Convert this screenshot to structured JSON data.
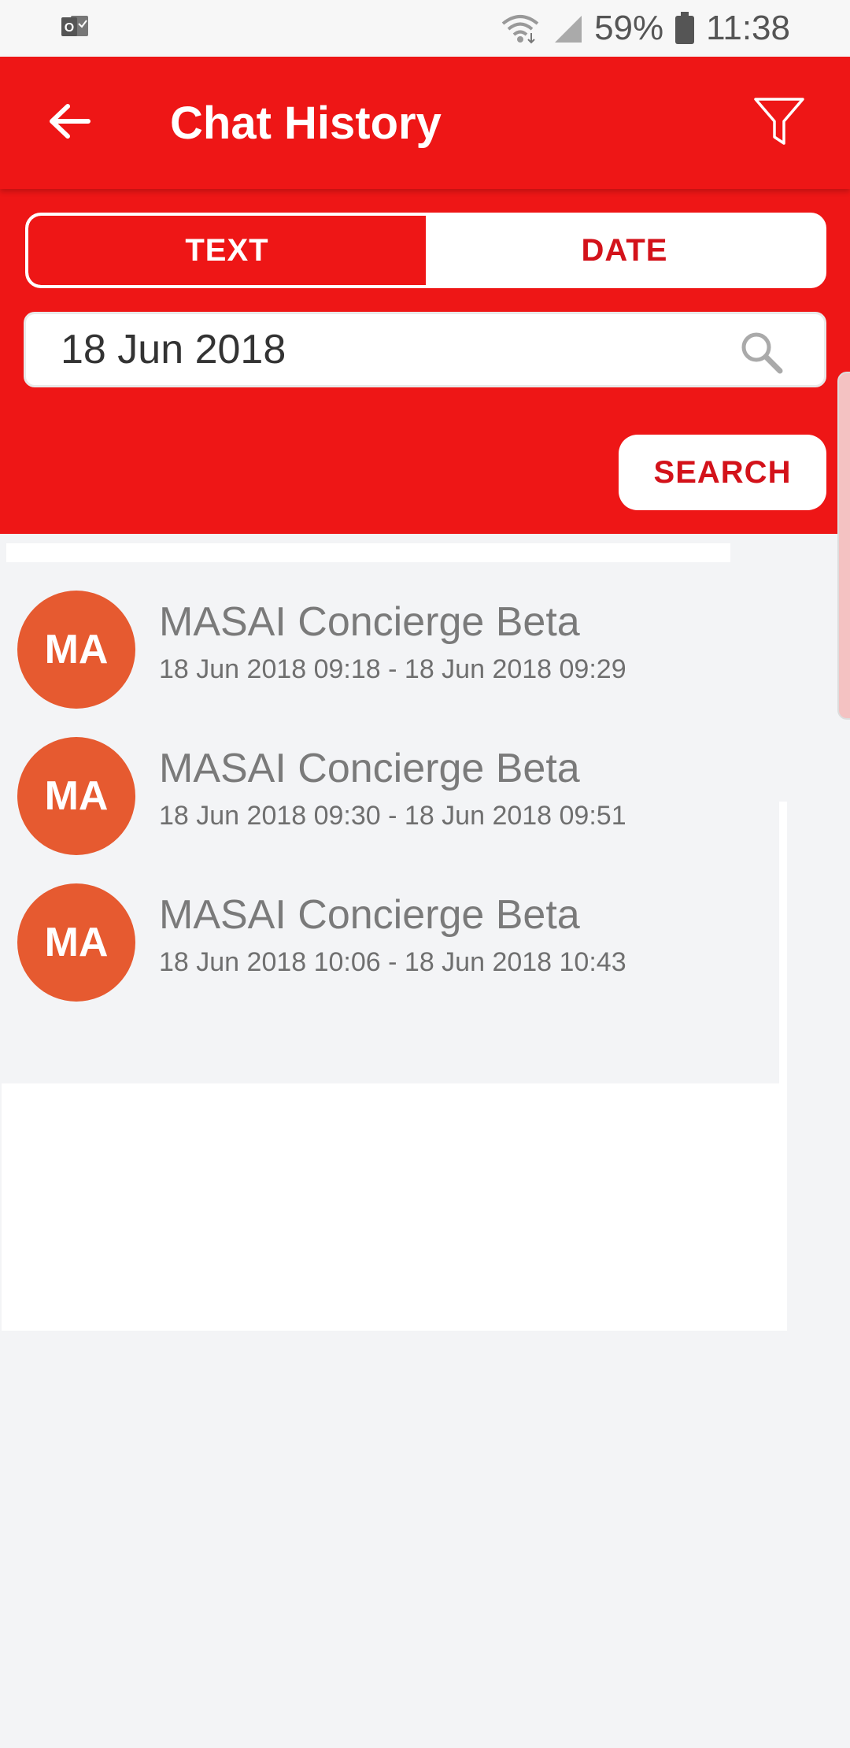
{
  "status_bar": {
    "notification_icon": "outlook-icon",
    "battery_percent": "59%",
    "time": "11:38"
  },
  "header": {
    "back_icon": "arrow-left-icon",
    "title": "Chat History",
    "filter_icon": "filter-icon"
  },
  "search": {
    "mode_tabs": [
      "TEXT",
      "DATE"
    ],
    "active_mode": "TEXT",
    "query_value": "18 Jun 2018",
    "search_icon": "magnifier-icon",
    "button_label": "SEARCH"
  },
  "chats": [
    {
      "initials": "MA",
      "name": "MASAI Concierge Beta",
      "time_range": "18 Jun 2018 09:18 - 18 Jun 2018 09:29"
    },
    {
      "initials": "MA",
      "name": "MASAI Concierge Beta",
      "time_range": "18 Jun 2018 09:30 - 18 Jun 2018 09:51"
    },
    {
      "initials": "MA",
      "name": "MASAI Concierge Beta",
      "time_range": "18 Jun 2018 10:06 - 18 Jun 2018 10:43"
    }
  ],
  "colors": {
    "primary": "#ee1616",
    "accent_text": "#d3121a",
    "avatar": "#e65a30"
  }
}
